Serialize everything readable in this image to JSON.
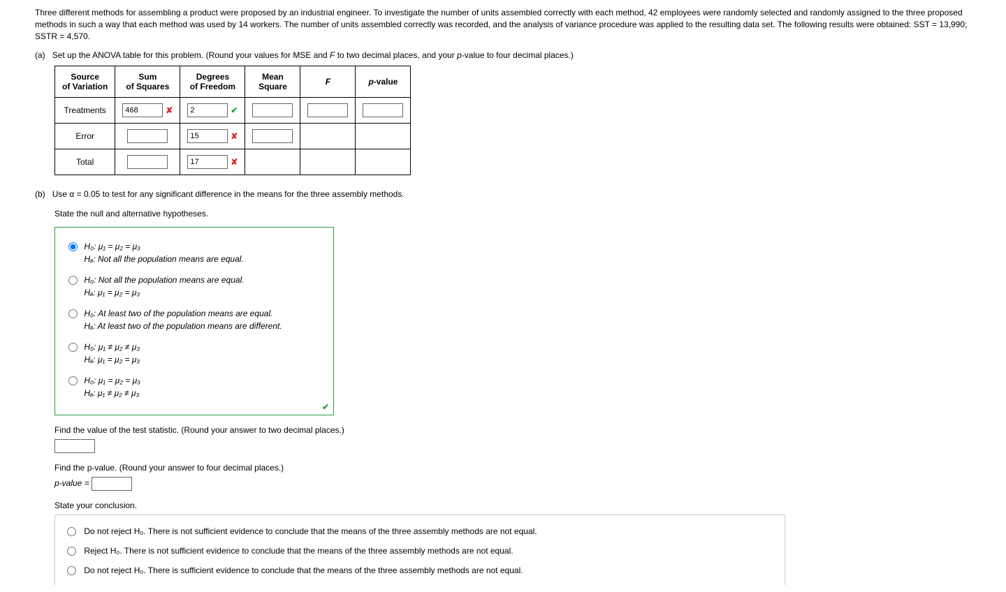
{
  "intro": "Three different methods for assembling a product were proposed by an industrial engineer. To investigate the number of units assembled correctly with each method, 42 employees were randomly selected and randomly assigned to the three proposed methods in such a way that each method was used by 14 workers. The number of units assembled correctly was recorded, and the analysis of variance procedure was applied to the resulting data set. The following results were obtained: SST = 13,990; SSTR = 4,570.",
  "partA": {
    "label": "(a)",
    "prompt": "Set up the ANOVA table for this problem. (Round your values for MSE and F to two decimal places, and your p-value to four decimal places.)",
    "headers": {
      "c1": "Source\nof Variation",
      "c2": "Sum\nof Squares",
      "c3": "Degrees\nof Freedom",
      "c4": "Mean\nSquare",
      "c5": "F",
      "c6": "p-value"
    },
    "rows": {
      "treatments": {
        "label": "Treatments",
        "ss_value": "468",
        "ss_mark": "cross",
        "df_value": "2",
        "df_mark": "check",
        "ms_value": "",
        "f_value": "",
        "p_value": ""
      },
      "error": {
        "label": "Error",
        "ss_value": "",
        "df_value": "15",
        "df_mark": "cross",
        "ms_value": ""
      },
      "total": {
        "label": "Total",
        "ss_value": "",
        "df_value": "17",
        "df_mark": "cross"
      }
    }
  },
  "partB": {
    "label": "(b)",
    "prompt_line1": "Use α = 0.05 to test for any significant difference in the means for the three assembly methods.",
    "prompt_line2": "State the null and alternative hypotheses.",
    "options": {
      "o1": {
        "h0": "H₀: μ₁ = μ₂ = μ₃",
        "ha": "Hₐ: Not all the population means are equal."
      },
      "o2": {
        "h0": "H₀: Not all the population means are equal.",
        "ha": "Hₐ: μ₁ = μ₂ = μ₃"
      },
      "o3": {
        "h0": "H₀: At least two of the population means are equal.",
        "ha": "Hₐ: At least two of the population means are different."
      },
      "o4": {
        "h0": "H₀: μ₁ ≠ μ₂ ≠ μ₃",
        "ha": "Hₐ: μ₁ = μ₂ = μ₃"
      },
      "o5": {
        "h0": "H₀: μ₁ = μ₂ = μ₃",
        "ha": "Hₐ: μ₁ ≠ μ₂ ≠ μ₃"
      }
    },
    "test_stat_prompt": "Find the value of the test statistic. (Round your answer to two decimal places.)",
    "pvalue_prompt": "Find the p-value. (Round your answer to four decimal places.)",
    "pvalue_label": "p-value = ",
    "conclusion_prompt": "State your conclusion.",
    "conclusions": {
      "c1": "Do not reject H₀. There is not sufficient evidence to conclude that the means of the three assembly methods are not equal.",
      "c2": "Reject H₀. There is not sufficient evidence to conclude that the means of the three assembly methods are not equal.",
      "c3": "Do not reject H₀. There is sufficient evidence to conclude that the means of the three assembly methods are not equal."
    }
  }
}
